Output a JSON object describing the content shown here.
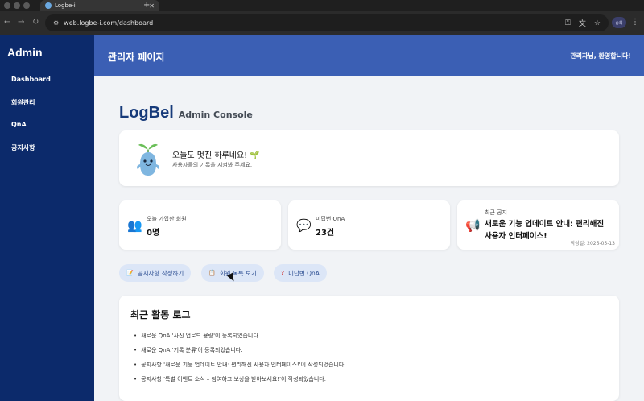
{
  "browser": {
    "tab_title": "Logbe-i",
    "tab_close": "✕",
    "new_tab": "+",
    "url": "web.logbe-i.com/dashboard",
    "profile_label": "승희"
  },
  "sidebar": {
    "title": "Admin",
    "items": [
      {
        "label": "Dashboard"
      },
      {
        "label": "회원관리"
      },
      {
        "label": "QnA"
      },
      {
        "label": "공지사항"
      }
    ]
  },
  "header": {
    "title": "관리자 페이지",
    "welcome": "관리자님, 환영합니다!"
  },
  "brand": {
    "name": "LogBel",
    "subtitle": "Admin Console"
  },
  "greeting": {
    "title": "오늘도 멋진 하루네요! 🌱",
    "subtitle": "사용자들의 기록을 지켜봐 주세요."
  },
  "stats": {
    "signups": {
      "label": "오늘 가입한 회원",
      "value": "0명",
      "icon": "people-icon"
    },
    "unanswered": {
      "label": "미답변 QnA",
      "value": "23건",
      "icon": "speech-bubble-icon"
    },
    "notice": {
      "label": "최근 공지",
      "title": "새로운 기능 업데이트 안내: 편리해진 사용자 인터페이스!",
      "date": "작성일: 2025-05-13",
      "icon": "megaphone-icon"
    }
  },
  "quick_actions": [
    {
      "label": "공지사항 작성하기",
      "icon": "pencil-icon"
    },
    {
      "label": "회원 목록 보기",
      "icon": "clipboard-icon"
    },
    {
      "label": "미답변 QnA",
      "icon": "question-icon"
    }
  ],
  "activity_log": {
    "title": "최근 활동 로그",
    "items": [
      "새로운 QnA '사진 업로드 용량'이 등록되었습니다.",
      "새로운 QnA '기록 분류'이 등록되었습니다.",
      "공지사항 '새로운 기능 업데이트 안내: 편리해진 사용자 인터페이스!'이 작성되었습니다.",
      "공지사항 '특별 이벤트 소식 – 참여하고 보상을 받아보세요!'이 작성되었습니다."
    ]
  },
  "colors": {
    "sidebar_bg": "#0c2a6b",
    "header_bg": "#3b5fb4",
    "brand_text": "#163a7a",
    "action_pill_bg": "#dce6f7"
  }
}
